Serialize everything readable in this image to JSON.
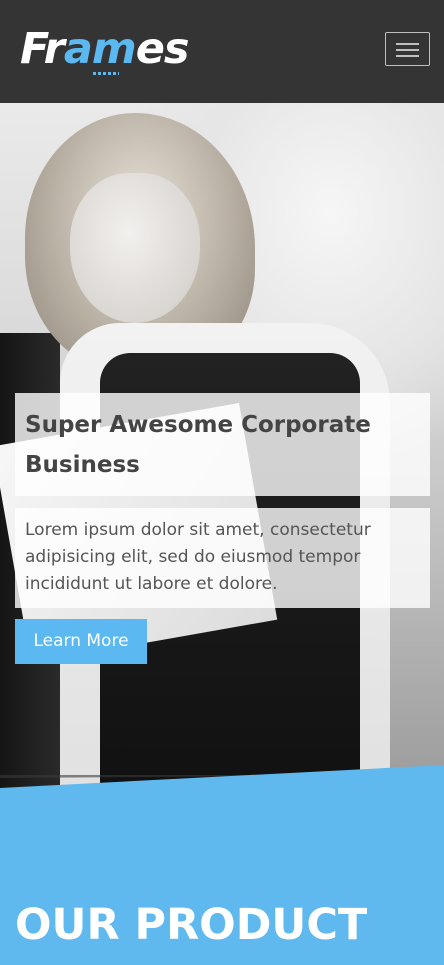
{
  "header": {
    "logo_prefix": "Fr",
    "logo_accent": "am",
    "logo_suffix": "es",
    "menu_icon": "hamburger-menu-icon",
    "background_color": "#343434",
    "accent_color": "#5bb8f0"
  },
  "hero": {
    "title": "Super Awesome Corporate Business",
    "text": "Lorem ipsum dolor sit amet, consectetur adipisicing elit, sed do eiusmod tempor incididunt ut labore et dolore.",
    "button_label": "Learn More"
  },
  "product": {
    "title": "OUR PRODUCT",
    "background_color": "#5fb9ef"
  }
}
